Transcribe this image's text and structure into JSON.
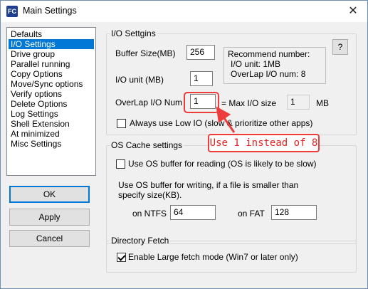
{
  "window": {
    "title": "Main Settings",
    "app_icon": "FC",
    "close_glyph": "✕"
  },
  "nav": {
    "items": [
      {
        "label": "Defaults",
        "selected": false
      },
      {
        "label": "I/O Settings",
        "selected": true
      },
      {
        "label": "Drive group",
        "selected": false
      },
      {
        "label": "Parallel running",
        "selected": false
      },
      {
        "label": "Copy Options",
        "selected": false
      },
      {
        "label": "Move/Sync options",
        "selected": false
      },
      {
        "label": "Verify options",
        "selected": false
      },
      {
        "label": "Delete Options",
        "selected": false
      },
      {
        "label": "Log Settings",
        "selected": false
      },
      {
        "label": "Shell Extension",
        "selected": false
      },
      {
        "label": "At minimized",
        "selected": false
      },
      {
        "label": "Misc Settings",
        "selected": false
      }
    ]
  },
  "buttons": {
    "ok": "OK",
    "apply": "Apply",
    "cancel": "Cancel"
  },
  "io": {
    "legend": "I/O Settgins",
    "help_label": "?",
    "buffer_size_label": "Buffer Size(MB)",
    "buffer_size_value": "256",
    "io_unit_label": "I/O unit (MB)",
    "io_unit_value": "1",
    "overlap_label": "OverLap I/O Num",
    "overlap_value": "1",
    "max_io_label": "= Max I/O size",
    "max_io_value": "1",
    "max_io_unit": "MB",
    "recommend": {
      "heading": "Recommend number:",
      "io_unit": "I/O unit: 1MB",
      "overlap": "OverLap I/O num: 8"
    },
    "low_io_label": "Always use Low IO (slow & prioritize other apps)",
    "low_io_checked": false
  },
  "cache": {
    "legend": "OS Cache settings",
    "os_buffer_read_label": "Use OS buffer for reading (OS is likely to be slow)",
    "os_buffer_read_checked": false,
    "write_line1": "Use OS buffer for writing, if a file is smaller than",
    "write_line2": "specify size(KB).",
    "ntfs_label": "on NTFS",
    "ntfs_value": "64",
    "fat_label": "on FAT",
    "fat_value": "128"
  },
  "dir": {
    "legend": "Directory Fetch",
    "large_fetch_label": "Enable Large fetch mode (Win7 or later only)",
    "large_fetch_checked": true
  },
  "annotation": {
    "text": "Use 1 instead of 8",
    "color": "#ee3b3b"
  }
}
